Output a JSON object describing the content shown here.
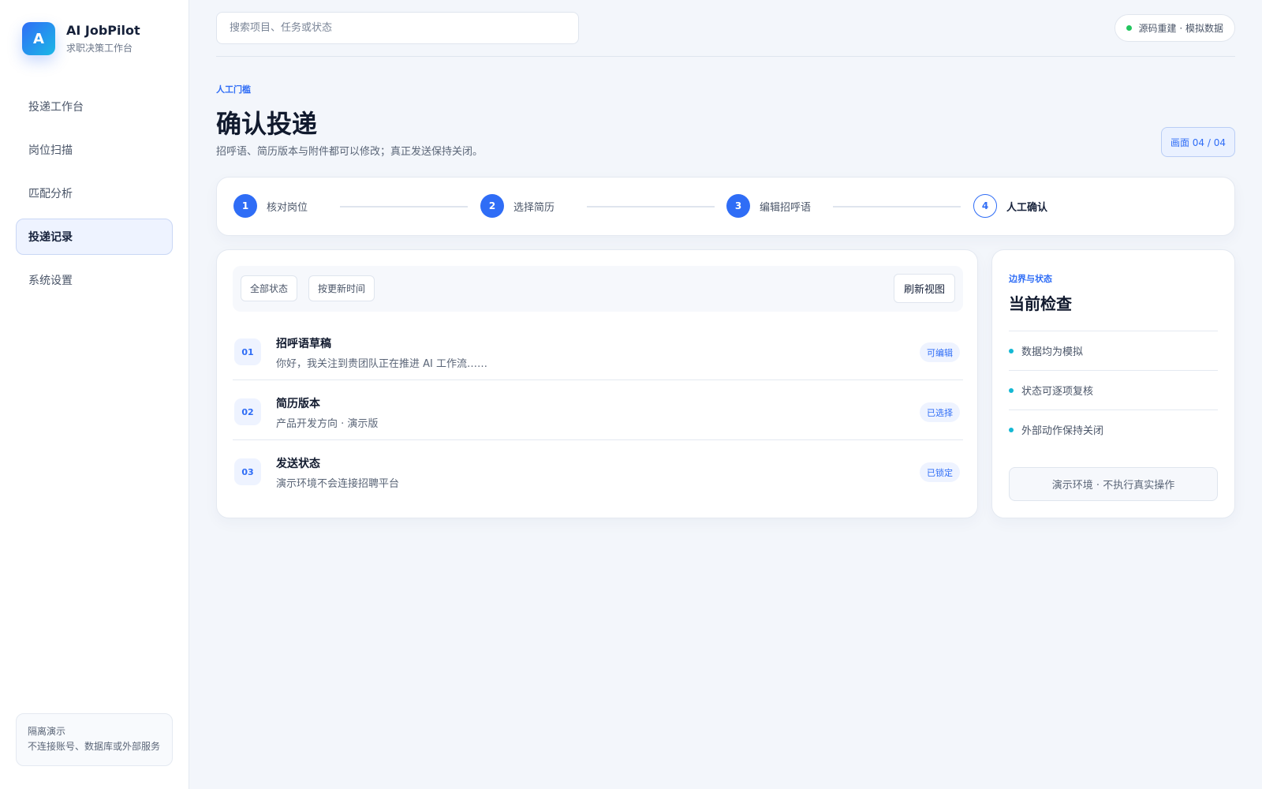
{
  "brand": {
    "logo_letter": "A",
    "name": "AI JobPilot",
    "subtitle": "求职决策工作台"
  },
  "sidebar": {
    "items": [
      {
        "label": "投递工作台",
        "active": false
      },
      {
        "label": "岗位扫描",
        "active": false
      },
      {
        "label": "匹配分析",
        "active": false
      },
      {
        "label": "投递记录",
        "active": true
      },
      {
        "label": "系统设置",
        "active": false
      }
    ],
    "note": {
      "title": "隔离演示",
      "text": "不连接账号、数据库或外部服务"
    }
  },
  "topbar": {
    "search_placeholder": "搜索项目、任务或状态",
    "status_text": "源码重建 · 模拟数据",
    "status_color": "#22c55e"
  },
  "header": {
    "eyebrow": "人工门槛",
    "title": "确认投递",
    "subtitle": "招呼语、简历版本与附件都可以修改；真正发送保持关闭。",
    "screen_badge": "画面 04 / 04"
  },
  "stepper": {
    "steps": [
      {
        "num": "1",
        "label": "核对岗位"
      },
      {
        "num": "2",
        "label": "选择简历"
      },
      {
        "num": "3",
        "label": "编辑招呼语"
      },
      {
        "num": "4",
        "label": "人工确认"
      }
    ]
  },
  "main": {
    "filters": [
      "全部状态",
      "按更新时间"
    ],
    "refresh_label": "刷新视图",
    "rows": [
      {
        "num": "01",
        "title": "招呼语草稿",
        "desc": "你好，我关注到贵团队正在推进 AI 工作流……",
        "tag": "可编辑"
      },
      {
        "num": "02",
        "title": "简历版本",
        "desc": "产品开发方向 · 演示版",
        "tag": "已选择"
      },
      {
        "num": "03",
        "title": "发送状态",
        "desc": "演示环境不会连接招聘平台",
        "tag": "已锁定"
      }
    ]
  },
  "side": {
    "eyebrow": "边界与状态",
    "title": "当前检查",
    "items": [
      "数据均为模拟",
      "状态可逐项复核",
      "外部动作保持关闭"
    ],
    "footer": "演示环境 · 不执行真实操作"
  },
  "colors": {
    "accent": "#2f6df6",
    "bullet": "#14b8d4"
  }
}
